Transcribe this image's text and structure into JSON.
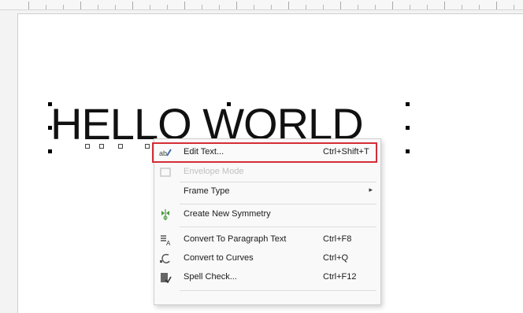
{
  "canvas": {
    "text": "HELLO WORLD"
  },
  "context_menu": {
    "items": [
      {
        "label": "Edit Text...",
        "shortcut": "Ctrl+Shift+T",
        "icon": "edit-text-icon",
        "state": "highlighted"
      },
      {
        "label": "Envelope Mode",
        "shortcut": "",
        "icon": "envelope-icon",
        "state": "disabled"
      },
      {
        "label": "Frame Type",
        "shortcut": "",
        "icon": "",
        "submenu_glyph": "▸"
      },
      {
        "label": "Create New Symmetry",
        "shortcut": "",
        "icon": "symmetry-icon"
      },
      {
        "label": "Convert To Paragraph Text",
        "shortcut": "Ctrl+F8",
        "icon": "paragraph-text-icon"
      },
      {
        "label": "Convert to Curves",
        "shortcut": "Ctrl+Q",
        "icon": "curves-icon"
      },
      {
        "label": "Spell Check...",
        "shortcut": "Ctrl+F12",
        "icon": "spell-check-icon"
      }
    ]
  },
  "colors": {
    "highlight_border": "#d42d35",
    "menu_background": "#f9f9f9"
  }
}
